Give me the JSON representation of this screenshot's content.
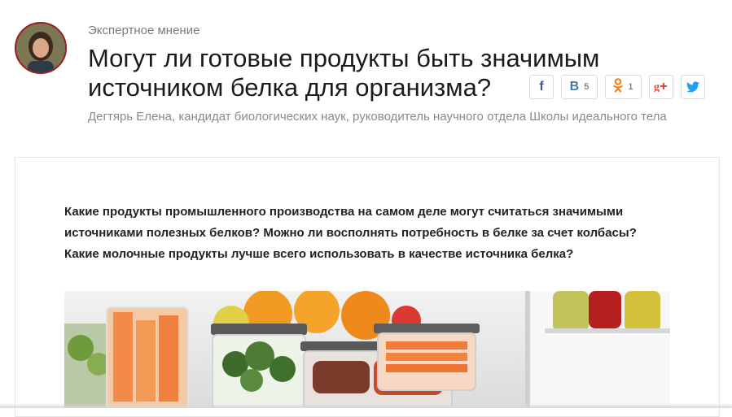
{
  "header": {
    "rubric": "Экспертное мнение",
    "title": "Могут ли готовые продукты быть значимым источником белка для организма?",
    "author": "Дегтярь Елена, кандидат биологических наук, руководитель научного отдела Школы идеального тела"
  },
  "share": {
    "facebook": {
      "icon": "facebook-icon",
      "glyph": "f"
    },
    "vk": {
      "icon": "vk-icon",
      "glyph": "B",
      "count": "5"
    },
    "ok": {
      "icon": "odnoklassniki-icon",
      "glyph": "ok",
      "count": "1"
    },
    "gplus": {
      "icon": "google-plus-icon",
      "glyph": "g+"
    },
    "twitter": {
      "icon": "twitter-icon"
    }
  },
  "article": {
    "lead": "Какие продукты промышленного производства на самом деле могут считаться значимыми источниками полезных белков? Можно ли восполнять потребность в белке за счет колбасы? Какие молочные продукты лучше всего использовать в качестве источника белка?"
  },
  "colors": {
    "facebook": "#3b5998",
    "vk": "#4a76a8",
    "ok": "#f58220",
    "gplus": "#dd4b39",
    "twitter": "#1da1f2",
    "avatar_ring": "#9b1b1e"
  }
}
